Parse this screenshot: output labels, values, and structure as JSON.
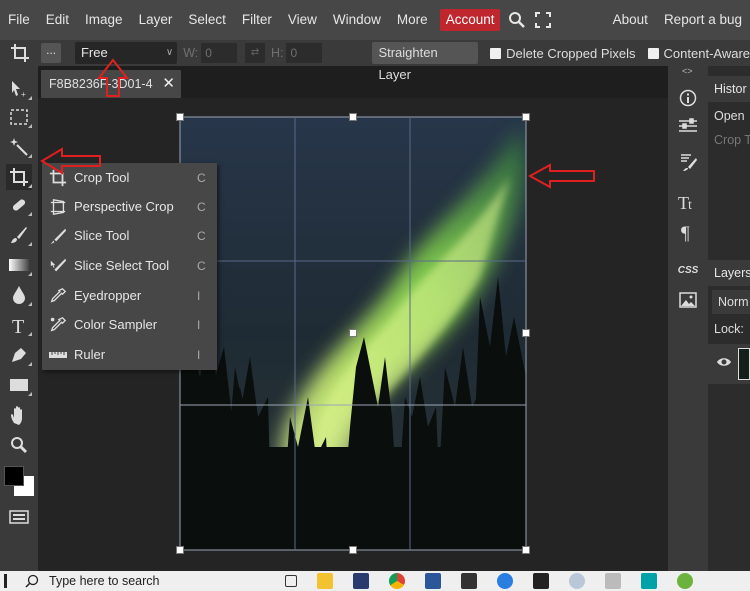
{
  "menu": {
    "items": [
      "File",
      "Edit",
      "Image",
      "Layer",
      "Select",
      "Filter",
      "View",
      "Window",
      "More"
    ],
    "account": "Account",
    "right_items": [
      "About",
      "Report a bug"
    ]
  },
  "options": {
    "dots": "...",
    "ratio": "Free",
    "width_label": "W:",
    "width_value": "0",
    "height_label": "H:",
    "height_value": "0",
    "straighten": "Straighten Layer",
    "delete_cropped": "Delete Cropped Pixels",
    "content_aware": "Content-Aware"
  },
  "document": {
    "tab_title": "F8B8236F-3D01-4"
  },
  "flyout": [
    {
      "label": "Crop Tool",
      "key": "C",
      "icon": "crop-icon"
    },
    {
      "label": "Perspective Crop",
      "key": "C",
      "icon": "perspective-crop-icon"
    },
    {
      "label": "Slice Tool",
      "key": "C",
      "icon": "slice-icon"
    },
    {
      "label": "Slice Select Tool",
      "key": "C",
      "icon": "slice-select-icon"
    },
    {
      "label": "Eyedropper",
      "key": "I",
      "icon": "eyedropper-icon"
    },
    {
      "label": "Color Sampler",
      "key": "I",
      "icon": "color-sampler-icon"
    },
    {
      "label": "Ruler",
      "key": "I",
      "icon": "ruler-icon"
    }
  ],
  "right_column": {
    "collapse": "<>",
    "css": "CSS"
  },
  "panels": {
    "history_title": "Histor",
    "history_items": [
      "Open",
      "Crop T"
    ],
    "layers_title": "Layers",
    "blend_mode": "Norm",
    "lock_label": "Lock:"
  },
  "taskbar": {
    "search_placeholder": "Type here to search"
  },
  "colors": {
    "menubar": "#474747",
    "account": "#c0262d",
    "annotation_arrow": "#e02020"
  }
}
